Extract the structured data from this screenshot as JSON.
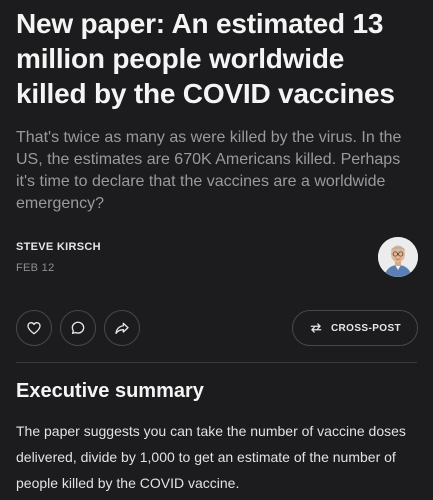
{
  "article": {
    "title": "New paper: An estimated 13 million people worldwide killed by the COVID vaccines",
    "subtitle": "That's twice as many as were killed by the virus. In the US, the estimates are 670K Americans killed. Perhaps it's time to declare that the vaccines are a worldwide emergency?",
    "author": "STEVE KIRSCH",
    "date": "FEB 12"
  },
  "actions": {
    "like_icon": "heart-icon",
    "comment_icon": "comment-icon",
    "share_icon": "share-icon",
    "crosspost_icon": "crosspost-arrows-icon",
    "crosspost_label": "CROSS-POST"
  },
  "content": {
    "section_heading": "Executive summary",
    "paragraph": "The paper suggests you can take the number of vaccine doses delivered, divide by 1,000 to get an estimate of the number of people killed by the COVID vaccine."
  },
  "colors": {
    "background": "#1c1c1e",
    "title_text": "#f4f4f4",
    "subtitle_text": "#9a9a9e",
    "border": "#48484c"
  }
}
